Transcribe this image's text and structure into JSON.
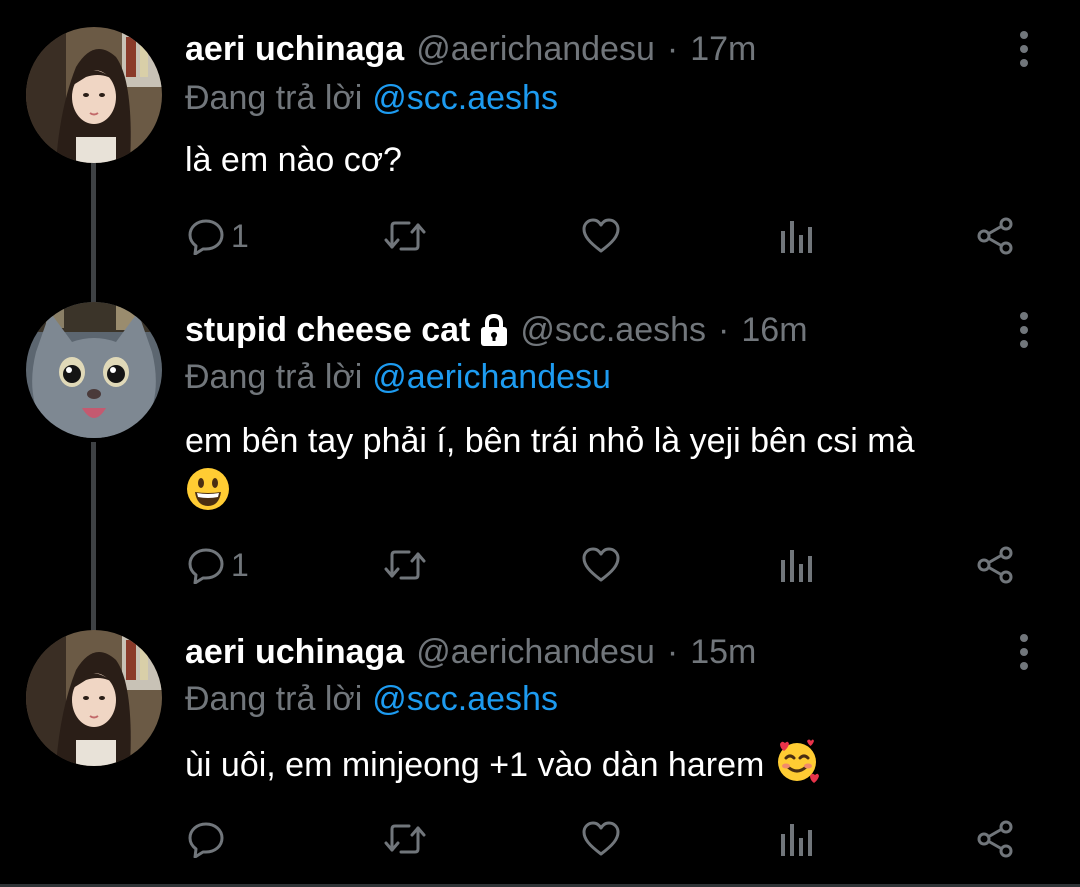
{
  "theme": {
    "background": "#000000",
    "name_color": "#ffffff",
    "muted_color": "#71767b",
    "link_color": "#1d9bf0",
    "thread_line_color": "#3e4144"
  },
  "tweets": [
    {
      "name": "aeri uchinaga",
      "handle": "@aerichandesu",
      "separator": "·",
      "time": "17m",
      "reply_prefix": "Đang trả lời",
      "reply_to": "@scc.aeshs",
      "text": "là em nào cơ?",
      "locked": false,
      "emoji": "",
      "reply_count": "1",
      "icons": [
        "reply-icon",
        "retweet-icon",
        "like-icon",
        "analytics-icon",
        "share-icon",
        "more-options-icon"
      ]
    },
    {
      "name": "stupid cheese cat",
      "handle": "@scc.aeshs",
      "separator": "·",
      "time": "16m",
      "reply_prefix": "Đang trả lời",
      "reply_to": "@aerichandesu",
      "text": "em bên tay phải í, bên trái nhỏ là yeji bên csi mà",
      "locked": true,
      "emoji": "grinning-face-emoji",
      "reply_count": "1",
      "icons": [
        "reply-icon",
        "retweet-icon",
        "like-icon",
        "analytics-icon",
        "share-icon",
        "more-options-icon"
      ]
    },
    {
      "name": "aeri uchinaga",
      "handle": "@aerichandesu",
      "separator": "·",
      "time": "15m",
      "reply_prefix": "Đang trả lời",
      "reply_to": "@scc.aeshs",
      "text": "ùi uôi, em minjeong +1 vào dàn harem",
      "locked": false,
      "emoji": "smiling-face-with-hearts-emoji",
      "reply_count": "",
      "icons": [
        "reply-icon",
        "retweet-icon",
        "like-icon",
        "analytics-icon",
        "share-icon",
        "more-options-icon"
      ]
    }
  ]
}
